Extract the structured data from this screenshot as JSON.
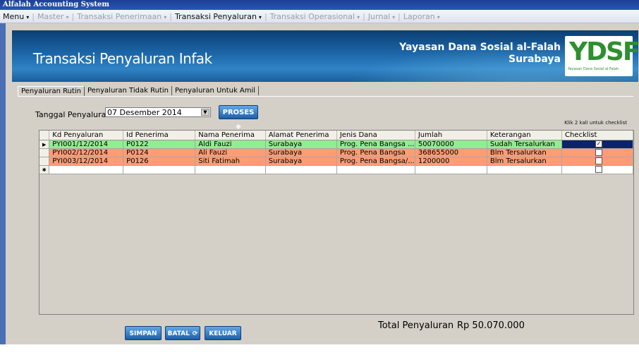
{
  "app_title": "Alfalah Accounting System",
  "menu": [
    {
      "label": "Menu",
      "active": true
    },
    {
      "label": "Master",
      "active": false
    },
    {
      "label": "Transaksi Penerimaan",
      "active": false
    },
    {
      "label": "Transaksi Penyaluran",
      "active": true
    },
    {
      "label": "Transaksi Operasional",
      "active": false
    },
    {
      "label": "Jurnal",
      "active": false
    },
    {
      "label": "Laporan",
      "active": false
    }
  ],
  "header": {
    "title": "Transaksi Penyaluran Infak",
    "org_name": "Yayasan Dana Sosial al-Falah",
    "org_city": "Surabaya",
    "logo_text": "YDSF",
    "logo_subtext": "Yayasan Dana Sosial al-Falah"
  },
  "tabs": [
    "Penyaluran Rutin",
    "Penyaluran Tidak Rutin",
    "Penyaluran Untuk Amil"
  ],
  "form": {
    "tanggal_label": "Tanggal Penyaluran",
    "tanggal_value": "07 Desember 2014",
    "proses_label": "PROSES",
    "checklist_hint": "Klik 2 kali untuk checklist"
  },
  "table": {
    "columns": [
      "Kd Penyaluran",
      "Id Penerima",
      "Nama Penerima",
      "Alamat Penerima",
      "Jenis Dana",
      "Jumlah",
      "Keterangan",
      "Checklist"
    ],
    "rows": [
      {
        "kd": "PYI001/12/2014",
        "id": "P0122",
        "nama": "Aldi Fauzi",
        "alamat": "Surabaya",
        "jenis": "Prog. Pena Bangsa ...",
        "jumlah": "50070000",
        "ket": "Sudah Tersalurkan",
        "checked": true,
        "status": "green",
        "indicator": "▶"
      },
      {
        "kd": "PYI002/12/2014",
        "id": "P0124",
        "nama": "Ali Fauzi",
        "alamat": "Surabaya",
        "jenis": "Prog. Pena Bangsa",
        "jumlah": "368655000",
        "ket": "Blm Tersalurkan",
        "checked": false,
        "status": "salmon",
        "indicator": ""
      },
      {
        "kd": "PYI003/12/2014",
        "id": "P0126",
        "nama": "Siti Fatimah",
        "alamat": "Surabaya",
        "jenis": "Prog. Pena Bangsa/...",
        "jumlah": "1200000",
        "ket": "Blm Tersalurkan",
        "checked": false,
        "status": "salmon",
        "indicator": ""
      }
    ],
    "new_row_indicator": "✱"
  },
  "footer": {
    "simpan_label": "SIMPAN",
    "batal_label": "BATAL",
    "keluar_label": "KELUAR",
    "total_label": "Total Penyaluran",
    "total_value": "Rp 50.070.000"
  },
  "colors": {
    "row_green": "#90ee90",
    "row_salmon": "#ff9c76",
    "header_blue": "#1c66a8",
    "logo_green": "#2e8f2e"
  }
}
